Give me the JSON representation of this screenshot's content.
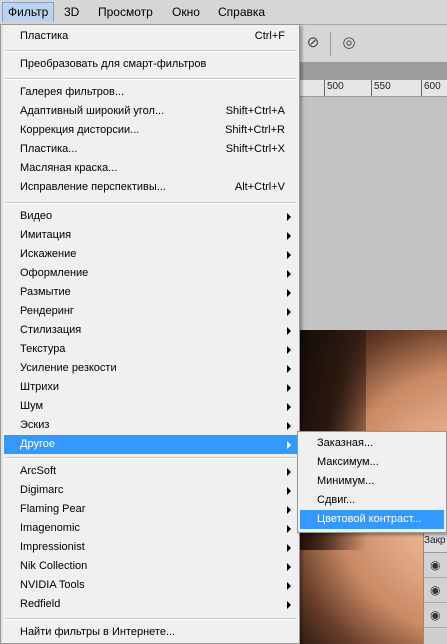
{
  "menubar": {
    "items": [
      {
        "label": "Фильтр",
        "active": true
      },
      {
        "label": "3D",
        "active": false
      },
      {
        "label": "Просмотр",
        "active": false
      },
      {
        "label": "Окно",
        "active": false
      },
      {
        "label": "Справка",
        "active": false
      }
    ]
  },
  "ruler": {
    "labels": [
      "500",
      "550",
      "600"
    ]
  },
  "layers_panel": {
    "tab_label": "Закр"
  },
  "filter_menu": {
    "groups": [
      [
        {
          "label": "Пластика",
          "shortcut": "Ctrl+F"
        }
      ],
      [
        {
          "label": "Преобразовать для смарт-фильтров"
        }
      ],
      [
        {
          "label": "Галерея фильтров..."
        },
        {
          "label": "Адаптивный широкий угол...",
          "shortcut": "Shift+Ctrl+A"
        },
        {
          "label": "Коррекция дисторсии...",
          "shortcut": "Shift+Ctrl+R"
        },
        {
          "label": "Пластика...",
          "shortcut": "Shift+Ctrl+X"
        },
        {
          "label": "Масляная краска..."
        },
        {
          "label": "Исправление перспективы...",
          "shortcut": "Alt+Ctrl+V"
        }
      ],
      [
        {
          "label": "Видео",
          "submenu": true
        },
        {
          "label": "Имитация",
          "submenu": true
        },
        {
          "label": "Искажение",
          "submenu": true
        },
        {
          "label": "Оформление",
          "submenu": true
        },
        {
          "label": "Размытие",
          "submenu": true
        },
        {
          "label": "Рендеринг",
          "submenu": true
        },
        {
          "label": "Стилизация",
          "submenu": true
        },
        {
          "label": "Текстура",
          "submenu": true
        },
        {
          "label": "Усиление резкости",
          "submenu": true
        },
        {
          "label": "Штрихи",
          "submenu": true
        },
        {
          "label": "Шум",
          "submenu": true
        },
        {
          "label": "Эскиз",
          "submenu": true
        },
        {
          "label": "Другое",
          "submenu": true,
          "highlighted": true
        }
      ],
      [
        {
          "label": "ArcSoft",
          "submenu": true
        },
        {
          "label": "Digimarc",
          "submenu": true
        },
        {
          "label": "Flaming Pear",
          "submenu": true
        },
        {
          "label": "Imagenomic",
          "submenu": true
        },
        {
          "label": "Impressionist",
          "submenu": true
        },
        {
          "label": "Nik Collection",
          "submenu": true
        },
        {
          "label": "NVIDIA Tools",
          "submenu": true
        },
        {
          "label": "Redfield",
          "submenu": true
        }
      ],
      [
        {
          "label": "Найти фильтры в Интернете..."
        }
      ]
    ]
  },
  "other_submenu": {
    "items": [
      {
        "label": "Заказная..."
      },
      {
        "label": "Максимум..."
      },
      {
        "label": "Минимум..."
      },
      {
        "label": "Сдвиг..."
      },
      {
        "label": "Цветовой контраст...",
        "highlighted": true
      }
    ]
  },
  "colors": {
    "highlight": "#3399ff",
    "menu_bg": "#f0f0f0"
  }
}
